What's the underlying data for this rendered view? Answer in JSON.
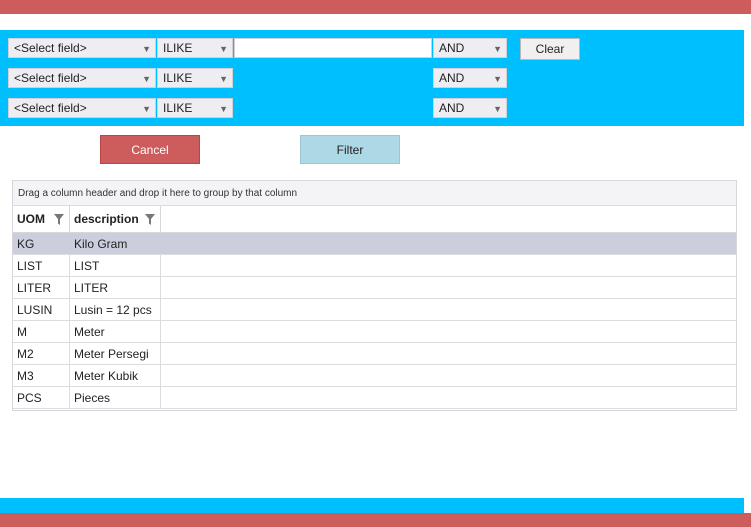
{
  "filter": {
    "rows": [
      {
        "field": "<Select field>",
        "operator": "ILIKE",
        "value": "",
        "logic": "AND",
        "has_input": true
      },
      {
        "field": "<Select field>",
        "operator": "ILIKE",
        "value": "",
        "logic": "AND",
        "has_input": false
      },
      {
        "field": "<Select field>",
        "operator": "ILIKE",
        "value": "",
        "logic": "AND",
        "has_input": false
      }
    ],
    "clear_label": "Clear"
  },
  "actions": {
    "cancel_label": "Cancel",
    "filter_label": "Filter"
  },
  "grid": {
    "group_hint": "Drag a column header and drop it here to group by that column",
    "columns": [
      "UOM",
      "description"
    ],
    "rows": [
      {
        "uom": "KG",
        "description": "Kilo Gram",
        "selected": true
      },
      {
        "uom": "LIST",
        "description": "LIST"
      },
      {
        "uom": "LITER",
        "description": "LITER"
      },
      {
        "uom": "LUSIN",
        "description": "Lusin = 12 pcs"
      },
      {
        "uom": "M",
        "description": "Meter"
      },
      {
        "uom": "M2",
        "description": "Meter Persegi"
      },
      {
        "uom": "M3",
        "description": "Meter Kubik"
      },
      {
        "uom": "PCS",
        "description": "Pieces"
      }
    ]
  },
  "colors": {
    "accent": "#00bfff",
    "frame": "#cd5c5c",
    "cancel": "#cd5c5c",
    "filter": "#add8e6",
    "selected_row": "#cbcfdd"
  }
}
